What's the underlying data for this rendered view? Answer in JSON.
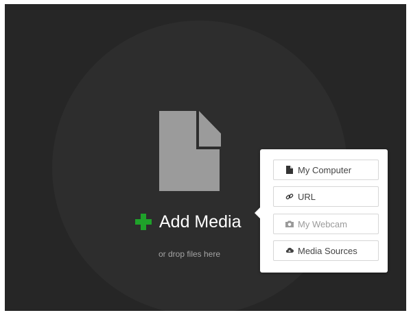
{
  "uploader": {
    "add_label": "Add Media",
    "drop_hint": "or drop files here",
    "accent_color": "#1fa22a",
    "icons": {
      "document": "document-icon",
      "plus": "plus-icon"
    }
  },
  "source_menu": {
    "items": [
      {
        "label": "My Computer",
        "icon": "file-icon",
        "enabled": true
      },
      {
        "label": "URL",
        "icon": "link-icon",
        "enabled": true
      },
      {
        "label": "My Webcam",
        "icon": "camera-icon",
        "enabled": false
      },
      {
        "label": "Media Sources",
        "icon": "cloud-icon",
        "enabled": true
      }
    ]
  }
}
